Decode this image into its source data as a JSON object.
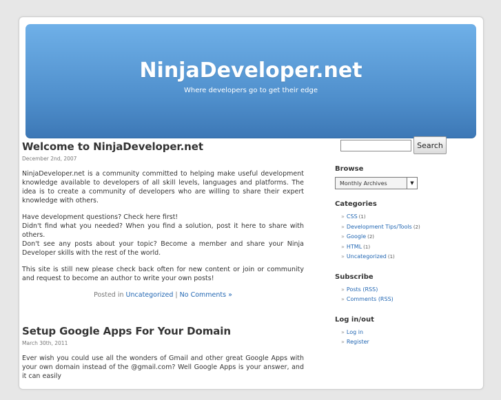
{
  "site": {
    "title": "NinjaDeveloper.net",
    "description": "Where developers go to get their edge"
  },
  "posts": [
    {
      "title": "Welcome to NinjaDeveloper.net",
      "date": "December 2nd, 2007",
      "paragraphs": [
        "NinjaDeveloper.net is a community committed to helping make useful development knowledge available to developers of all skill levels, languages and platforms. The idea is to create a community of developers who are willing to share their expert knowledge with others.",
        "Have development questions? Check here first!",
        "Didn't find what you needed? When you find a solution, post it here to share with others.",
        "Don't see any posts about your topic? Become a member and share your Ninja Developer skills with the rest of the world.",
        "This site is still new please check back often for new content or join or community and request to become an author to write your own posts!"
      ],
      "meta_prefix": "Posted in",
      "category": "Uncategorized",
      "separator": "|",
      "comments": "No Comments »"
    },
    {
      "title": "Setup Google Apps For Your Domain",
      "date": "March 30th, 2011",
      "paragraphs": [
        "Ever wish you could use all the wonders of Gmail and other great Google Apps with your own domain instead of the @gmail.com? Well Google Apps is your answer, and it can easily"
      ]
    }
  ],
  "sidebar": {
    "search_button": "Search",
    "search_value": "",
    "browse": {
      "heading": "Browse",
      "selected": "Monthly Archives"
    },
    "categories": {
      "heading": "Categories",
      "items": [
        {
          "label": "CSS",
          "count": "(1)"
        },
        {
          "label": "Development Tips/Tools",
          "count": "(2)"
        },
        {
          "label": "Google",
          "count": "(2)"
        },
        {
          "label": "HTML",
          "count": "(1)"
        },
        {
          "label": "Uncategorized",
          "count": "(1)"
        }
      ]
    },
    "subscribe": {
      "heading": "Subscribe",
      "items": [
        {
          "label": "Posts (RSS)"
        },
        {
          "label": "Comments (RSS)"
        }
      ]
    },
    "login": {
      "heading": "Log in/out",
      "items": [
        {
          "label": "Log in"
        },
        {
          "label": "Register"
        }
      ]
    },
    "bullet": "»"
  },
  "colors": {
    "header_top": "#6fb0e8",
    "header_bottom": "#3d78b6",
    "link": "#2267b3"
  }
}
